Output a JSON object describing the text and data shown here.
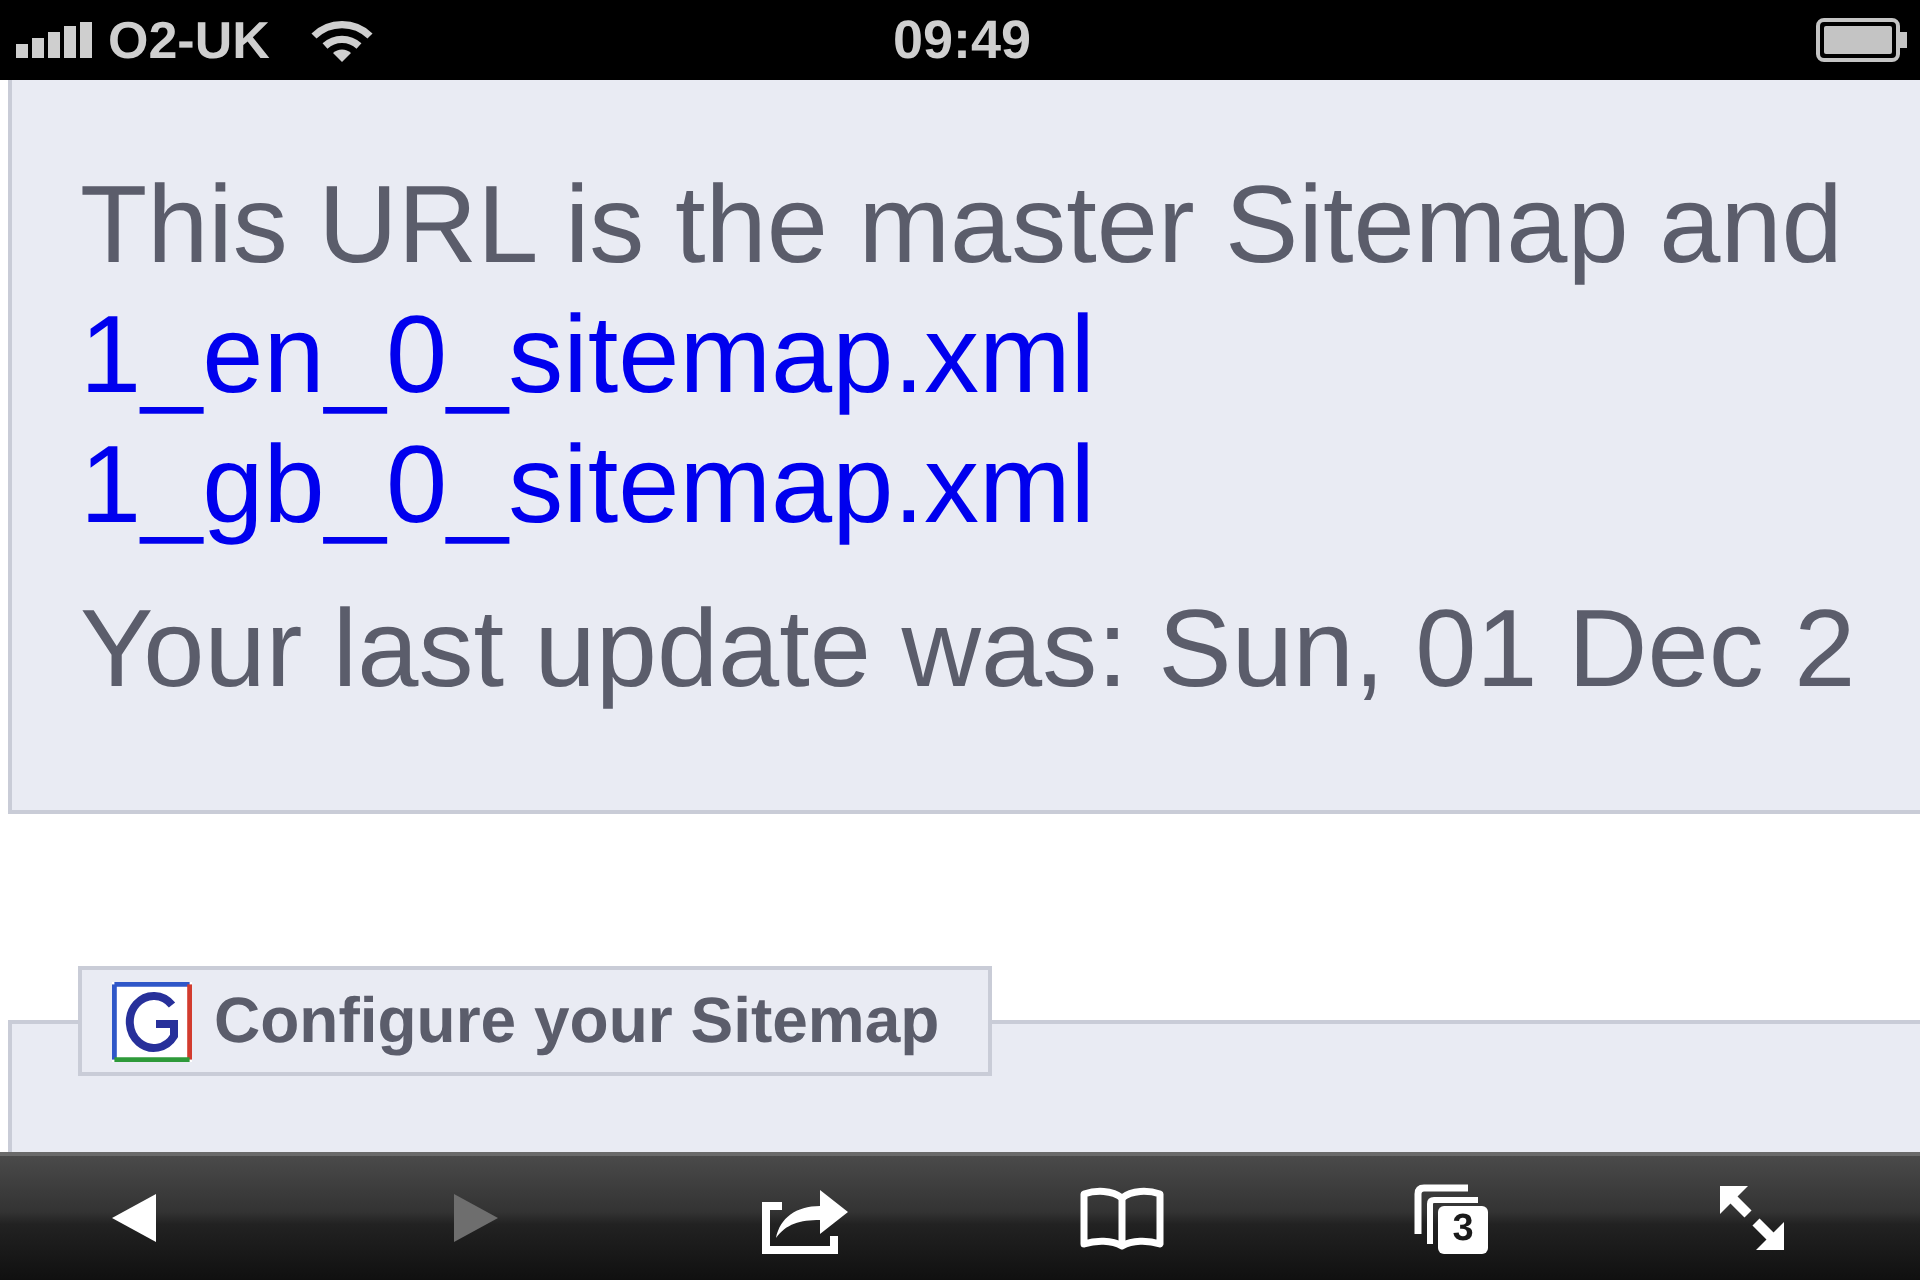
{
  "status_bar": {
    "carrier": "O2-UK",
    "time": "09:49"
  },
  "sitemap_panel": {
    "description": "This URL is the master Sitemap and",
    "links": [
      {
        "label": "1_en_0_sitemap.xml"
      },
      {
        "label": "1_gb_0_sitemap.xml"
      }
    ],
    "last_update": "Your last update was: Sun, 01 Dec 2"
  },
  "configure_section": {
    "title": "Configure your Sitemap"
  },
  "toolbar": {
    "buttons": [
      {
        "kind": "back",
        "disabled": false
      },
      {
        "kind": "forward",
        "disabled": true
      },
      {
        "kind": "share",
        "disabled": false
      },
      {
        "kind": "bookmarks",
        "disabled": false
      },
      {
        "kind": "tabs",
        "disabled": false,
        "count": "3"
      },
      {
        "kind": "fullscreen",
        "disabled": false
      }
    ]
  }
}
